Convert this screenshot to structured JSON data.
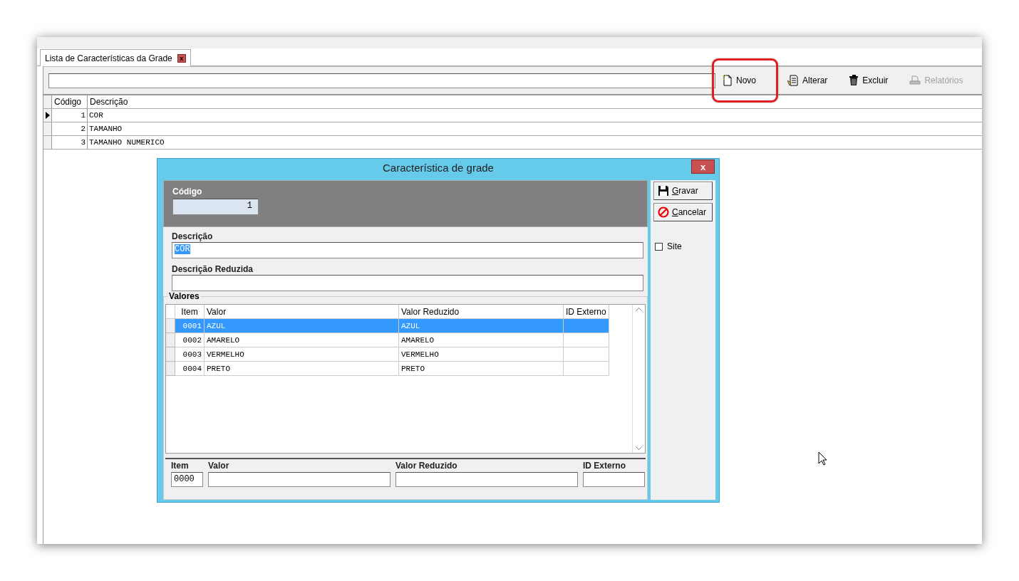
{
  "tab": {
    "label": "Lista de Características da Grade",
    "close": "x"
  },
  "toolbar": {
    "buttons": [
      {
        "label": "Novo",
        "kind": "new",
        "disabled": false,
        "highlighted": true
      },
      {
        "label": "Alterar",
        "kind": "edit",
        "disabled": false,
        "highlighted": false
      },
      {
        "label": "Excluir",
        "kind": "delete",
        "disabled": false,
        "highlighted": false
      },
      {
        "label": "Relatórios",
        "kind": "print",
        "disabled": true,
        "highlighted": false
      }
    ]
  },
  "grid": {
    "columns": [
      "Código",
      "Descrição"
    ],
    "rows": [
      {
        "code": "1",
        "description": "COR",
        "selected": true
      },
      {
        "code": "2",
        "description": "TAMANHO",
        "selected": false
      },
      {
        "code": "3",
        "description": "TAMANHO NUMERICO",
        "selected": false
      }
    ]
  },
  "dialog": {
    "title": "Característica de grade",
    "close": "x",
    "codigo": {
      "label": "Código",
      "value": "1"
    },
    "descricao": {
      "label": "Descrição",
      "value": "COR",
      "text_selected": true
    },
    "descricao_reduzida": {
      "label": "Descrição Reduzida"
    },
    "buttons": [
      {
        "label": "Gravar",
        "kind": "save"
      },
      {
        "label": "Cancelar",
        "kind": "cancel"
      }
    ],
    "site": {
      "label": "Site",
      "checked": false
    },
    "valores": {
      "title": "Valores",
      "columns": [
        "Item",
        "Valor",
        "Valor Reduzido",
        "ID Externo"
      ],
      "rows": [
        {
          "item": "0001",
          "valor": "AZUL",
          "valor_reduzido": "AZUL",
          "selected": true
        },
        {
          "item": "0002",
          "valor": "AMARELO",
          "valor_reduzido": "AMARELO",
          "selected": false
        },
        {
          "item": "0003",
          "valor": "VERMELHO",
          "valor_reduzido": "VERMELHO",
          "selected": false
        },
        {
          "item": "0004",
          "valor": "PRETO",
          "valor_reduzido": "PRETO",
          "selected": false
        }
      ],
      "editor": [
        {
          "label": "Item",
          "value": "0000"
        },
        {
          "label": "Valor"
        },
        {
          "label": "Valor Reduzido"
        },
        {
          "label": "ID Externo"
        }
      ]
    }
  }
}
